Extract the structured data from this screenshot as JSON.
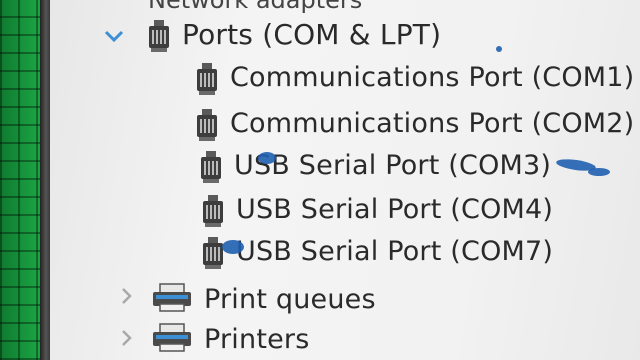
{
  "device_manager": {
    "partial_category": "Network adapters",
    "ports": {
      "label": "Ports (COM & LPT)",
      "expander_icon": "chevron-down-icon",
      "items": [
        {
          "label": "Communications Port (COM1)",
          "icon": "port-connector-icon"
        },
        {
          "label": "Communications Port (COM2)",
          "icon": "port-connector-icon"
        },
        {
          "label": "USB Serial Port (COM3)",
          "icon": "port-connector-icon"
        },
        {
          "label": "USB Serial Port (COM4)",
          "icon": "port-connector-icon"
        },
        {
          "label": "USB Serial Port (COM7)",
          "icon": "port-connector-icon"
        }
      ]
    },
    "print_queues": {
      "label": "Print queues",
      "icon": "printer-icon",
      "expander_icon": "chevron-right-icon"
    },
    "printers": {
      "label": "Printers",
      "icon": "printer-icon",
      "expander_icon": "chevron-right-icon"
    }
  },
  "colors": {
    "expander_accent": "#3c8fd6",
    "ink_marks": "#1f5fb0",
    "frame_green": "#1aa343"
  }
}
